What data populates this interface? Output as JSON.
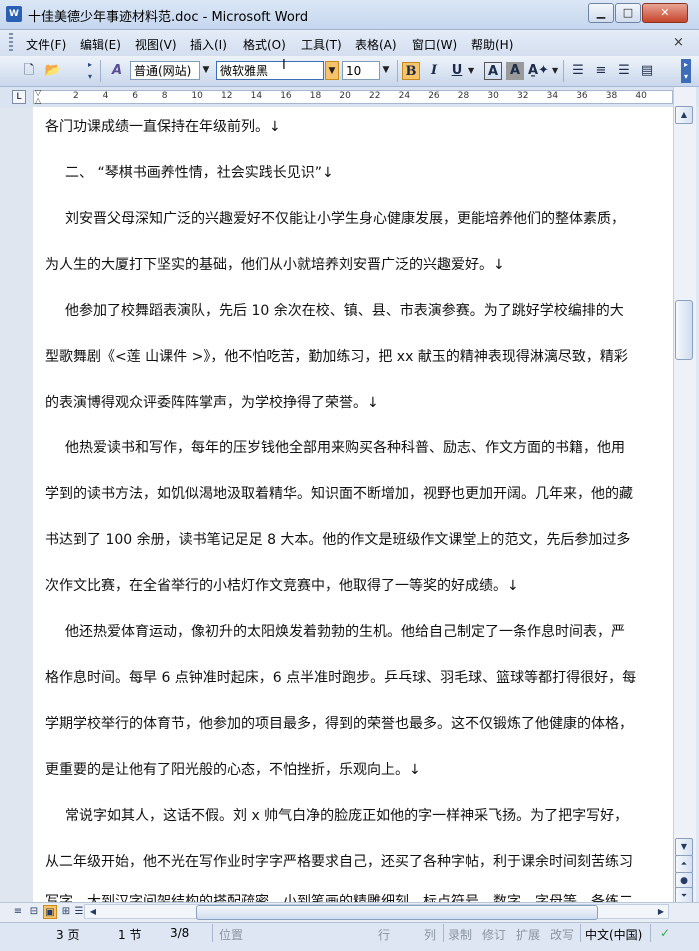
{
  "window": {
    "icon": "W",
    "title": "十佳美德少年事迹材料范.doc - Microsoft Word",
    "minimize_icon": "▁",
    "maximize_icon": "□",
    "close_icon": "✕"
  },
  "menu": {
    "items": [
      "文件(F)",
      "编辑(E)",
      "视图(V)",
      "插入(I)",
      "格式(O)",
      "工具(T)",
      "表格(A)",
      "窗口(W)",
      "帮助(H)"
    ],
    "close_glyph": "×"
  },
  "toolbar": {
    "style_value": "普通(网站)",
    "font_value": "微软雅黑",
    "size_value": "10",
    "bold": "B",
    "italic": "I",
    "underline": "U",
    "style_icon_label": "A",
    "font_color_label": "A",
    "highlight_label": "A"
  },
  "ruler": {
    "corner": "L",
    "numbers": [
      "2",
      "4",
      "6",
      "8",
      "10",
      "12",
      "14",
      "16",
      "18",
      "20",
      "22",
      "24",
      "26",
      "28",
      "30",
      "32",
      "34",
      "36",
      "38",
      "40"
    ]
  },
  "document": {
    "lines": [
      "各门功课成绩一直保持在年级前列。↓",
      "二、 “琴棋书画养性情，社会实践长见识”↓",
      "刘安晋父母深知广泛的兴趣爱好不仅能让小学生身心健康发展，更能培养他们的整体素质，",
      "为人生的大厦打下坚实的基础，他们从小就培养刘安晋广泛的兴趣爱好。↓",
      "他参加了校舞蹈表演队，先后 10 余次在校、镇、县、市表演参赛。为了跳好学校编排的大",
      "型歌舞剧《<莲  山课件  >》，他不怕吃苦，勤加练习，把 xx 献玉的精神表现得淋漓尽致，精彩",
      "的表演博得观众评委阵阵掌声，为学校挣得了荣誉。↓",
      "他热爱读书和写作，每年的压岁钱他全部用来购买各种科普、励志、作文方面的书籍，他用",
      "学到的读书方法，如饥似渴地汲取着精华。知识面不断增加，视野也更加开阔。几年来，他的藏",
      "书达到了 100 余册，读书笔记足足 8 大本。他的作文是班级作文课堂上的范文，先后参加过多",
      "次作文比赛，在全省举行的小桔灯作文竞赛中，他取得了一等奖的好成绩。↓",
      "他还热爱体育运动，像初升的太阳焕发着勃勃的生机。他给自己制定了一条作息时间表，严",
      "格作息时间。每早 6 点钟准时起床，6 点半准时跑步。乒乓球、羽毛球、篮球等都打得很好，每",
      "学期学校举行的体育节，他参加的项目最多，得到的荣誉也最多。这不仅锻炼了他健康的体格，",
      "更重要的是让他有了阳光般的心态，不怕挫折，乐观向上。↓",
      "常说字如其人，这话不假。刘 x 帅气白净的脸庞正如他的字一样神采飞扬。为了把字写好，",
      "从二年级开始，他不光在写作业时字字严格要求自己，还买了各种字帖，利于课余时间刻苦练习",
      "写字。大到汉字间架结构的搭配疏密，小到笔画的精雕细刻，标点符号，数字，字母等，备练二"
    ]
  },
  "status": {
    "page": "3 页",
    "section": "1 节",
    "page_of": "3/8",
    "position": "位置",
    "line": "行",
    "column": "列",
    "record": "录制",
    "revise": "修订",
    "extend": "扩展",
    "overwrite": "改写",
    "language": "中文(中国)"
  }
}
